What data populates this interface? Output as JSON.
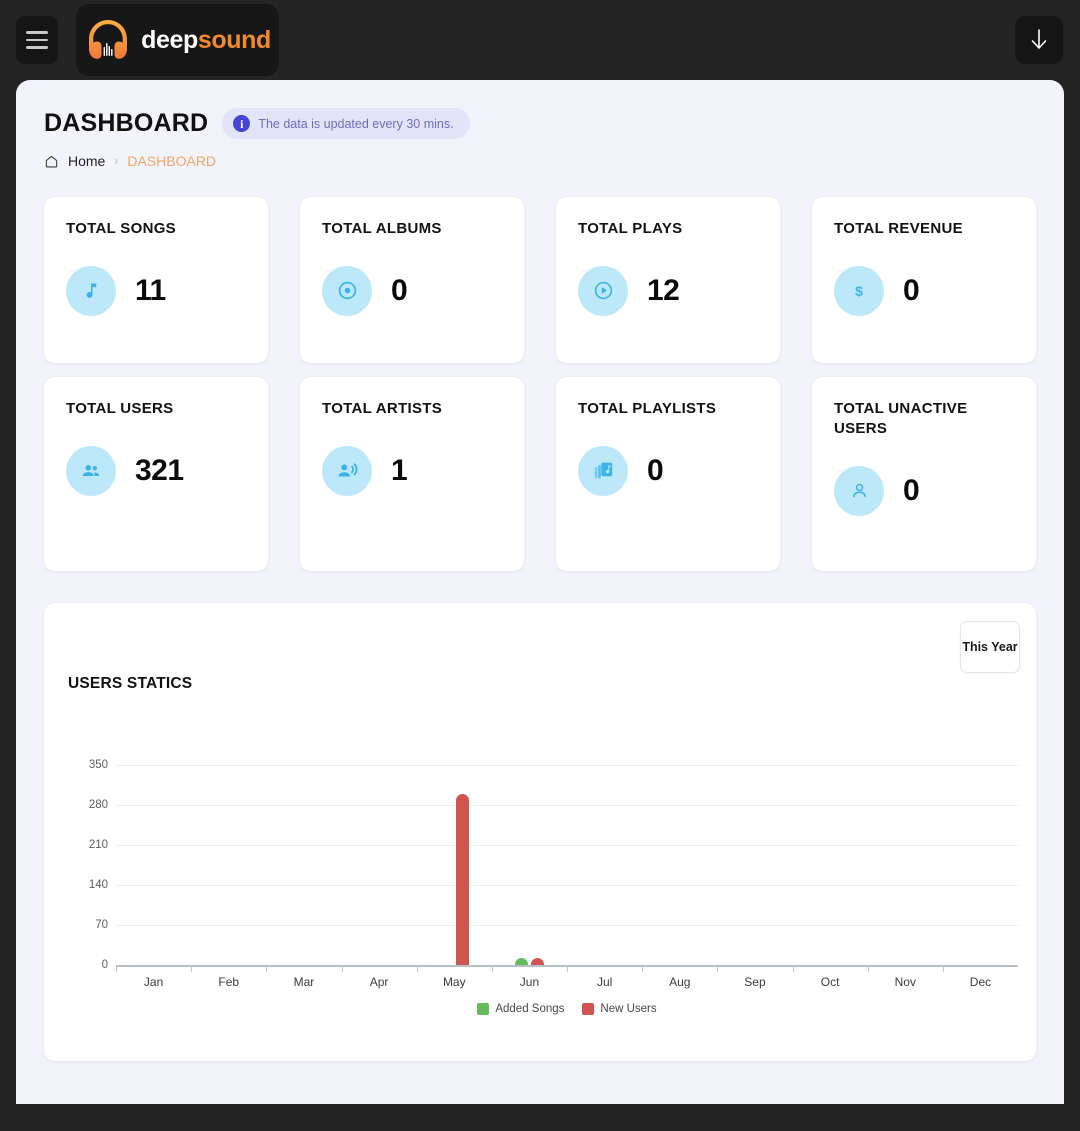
{
  "topbar": {
    "menu_icon": "hamburger-icon",
    "logo_icon": "headphones-icon",
    "logo_text_primary": "deep",
    "logo_text_accent": "sound",
    "download_icon": "arrow-down-icon",
    "logo_accent_color": "#f08a2a"
  },
  "header": {
    "title": "DASHBOARD",
    "info_badge": {
      "icon": "info-circle-icon",
      "text": "The data is updated every 30 mins.",
      "bg_color": "#e3e3fa",
      "text_color": "#6d6dbd"
    },
    "breadcrumb": {
      "home_icon": "home-icon",
      "home_label": "Home",
      "separator": "›",
      "current_label": "DASHBOARD",
      "current_color": "#f0a868"
    }
  },
  "stats": {
    "icon_bg_color": "#bde8fa",
    "icon_color": "#3bb3ea",
    "cards": [
      {
        "label": "TOTAL SONGS",
        "value": "11",
        "icon": "music-note-icon"
      },
      {
        "label": "TOTAL ALBUMS",
        "value": "0",
        "icon": "album-disc-icon"
      },
      {
        "label": "TOTAL PLAYS",
        "value": "12",
        "icon": "play-circle-icon"
      },
      {
        "label": "TOTAL REVENUE",
        "value": "0",
        "icon": "dollar-sign-icon"
      },
      {
        "label": "TOTAL USERS",
        "value": "321",
        "icon": "users-group-icon"
      },
      {
        "label": "TOTAL ARTISTS",
        "value": "1",
        "icon": "artist-voice-icon"
      },
      {
        "label": "TOTAL PLAYLISTS",
        "value": "0",
        "icon": "library-music-icon"
      },
      {
        "label": "TOTAL UNACTIVE USERS",
        "value": "0",
        "icon": "user-outline-icon"
      }
    ]
  },
  "chart_card": {
    "title": "USERS STATICS",
    "range_button_label": "This Year"
  },
  "chart_data": {
    "type": "bar",
    "title": "USERS STATICS",
    "xlabel": "",
    "ylabel": "",
    "categories": [
      "Jan",
      "Feb",
      "Mar",
      "Apr",
      "May",
      "Jun",
      "Jul",
      "Aug",
      "Sep",
      "Oct",
      "Nov",
      "Dec"
    ],
    "yticks": [
      0,
      70,
      140,
      210,
      280,
      350
    ],
    "ylim": [
      0,
      350
    ],
    "grid": true,
    "legend_position": "bottom",
    "series": [
      {
        "name": "Added Songs",
        "color": "#63bb5b",
        "values": [
          0,
          0,
          0,
          0,
          0,
          11,
          0,
          0,
          0,
          0,
          0,
          0
        ]
      },
      {
        "name": "New Users",
        "color": "#cf5550",
        "values": [
          0,
          0,
          0,
          0,
          300,
          9,
          0,
          0,
          0,
          0,
          0,
          0
        ]
      }
    ]
  }
}
